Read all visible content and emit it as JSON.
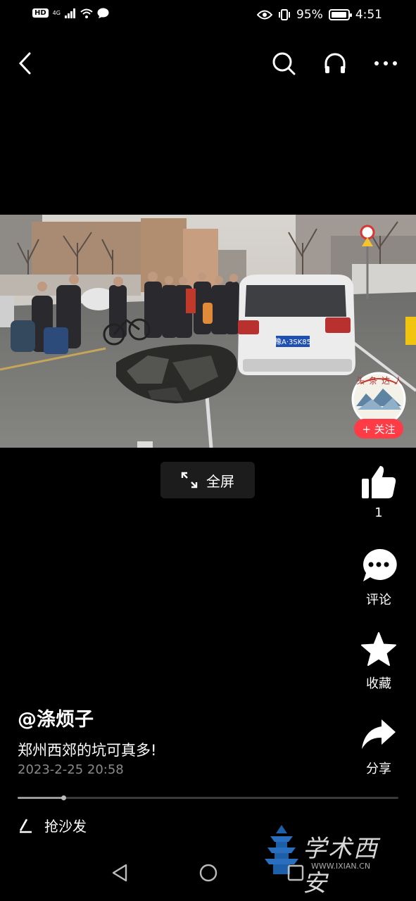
{
  "status_bar": {
    "battery": "95%",
    "time": "4:51",
    "network": "4G",
    "hd": "HD"
  },
  "video": {
    "fullscreen_label": "全屏",
    "plate": "豫A·3SK85",
    "follow_label": "+ 关注",
    "badge_text": "头条达人"
  },
  "actions": {
    "like_count": "1",
    "comment_label": "评论",
    "favorite_label": "收藏",
    "share_label": "分享"
  },
  "post": {
    "author": "@涤烦子",
    "caption": "郑州西郊的坑可真多!",
    "timestamp": "2023-2-25 20:58",
    "progress": 0.12
  },
  "comment": {
    "placeholder": "抢沙发"
  },
  "watermark": {
    "text": "学术西安",
    "url": "WWW.IXIAN.CN"
  }
}
